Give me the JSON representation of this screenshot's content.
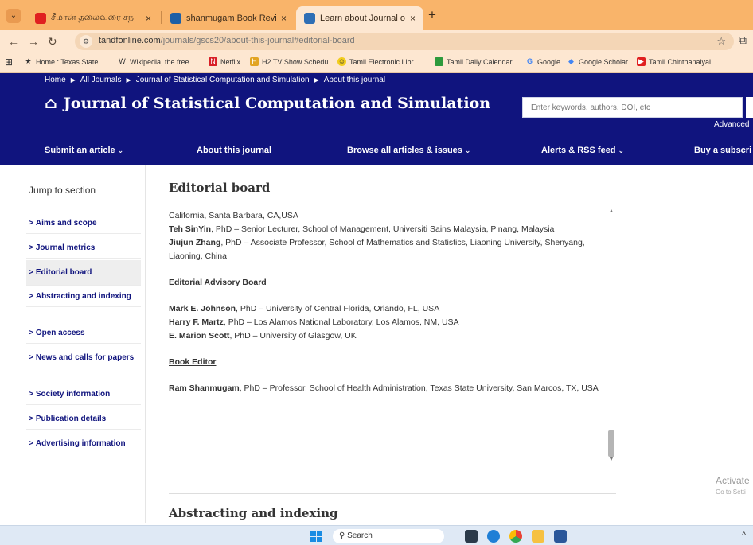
{
  "browser": {
    "tabs": [
      {
        "title": "சீமான் தலைவரை சந்",
        "active": false
      },
      {
        "title": "shanmugam Book Reviews - Sc",
        "active": false
      },
      {
        "title": "Learn about Journal of Statistic",
        "active": true
      }
    ],
    "new_tab": "+",
    "url_domain": "tandfonline.com",
    "url_path": "/journals/gscs20/about-this-journal#editorial-board",
    "bookmarks": [
      "Home : Texas State...",
      "Wikipedia, the free...",
      "Netflix",
      "H2 TV Show Schedu...",
      "Tamil Electronic Libr...",
      "Tamil Daily Calendar...",
      "Google",
      "Google Scholar",
      "Tamil Chinthanaiyal..."
    ]
  },
  "site": {
    "breadcrumb": [
      "Home",
      "All Journals",
      "Journal of Statistical Computation and Simulation",
      "About this journal"
    ],
    "journal_title": "Journal of Statistical Computation and Simulation",
    "search_placeholder": "Enter keywords, authors, DOI, etc",
    "advanced_search": "Advanced",
    "nav": [
      "Submit an article",
      "About this journal",
      "Browse all articles & issues",
      "Alerts & RSS feed",
      "Buy a subscri"
    ]
  },
  "sidebar": {
    "jump_label": "Jump to section",
    "items": [
      "Aims and scope",
      "Journal metrics",
      "Editorial board",
      "Abstracting and indexing",
      "Open access",
      "News and calls for papers",
      "Society information",
      "Publication details",
      "Advertising information"
    ]
  },
  "content": {
    "section_title": "Editorial board",
    "line_1": "California, Santa Barbara, CA,USA",
    "teh_name": "Teh SinYin",
    "teh_rest": ", PhD – Senior Lecturer, School of Management, Universiti Sains Malaysia, Pinang, Malaysia",
    "jiujun_name": "Jiujun Zhang",
    "jiujun_rest": ", PhD – Associate Professor, School of Mathematics and Statistics, Liaoning University, Shenyang, Liaoning, China",
    "advisory_heading": "Editorial Advisory Board",
    "advisory": [
      {
        "name": "Mark E. Johnson",
        "rest": ", PhD – University of Central Florida, Orlando, FL, USA"
      },
      {
        "name": "Harry F. Martz",
        "rest": ", PhD – Los Alamos National Laboratory, Los Alamos, NM, USA"
      },
      {
        "name": "E. Marion Scott",
        "rest": ", PhD – University of Glasgow, UK"
      }
    ],
    "book_heading": "Book Editor",
    "ram_name": "Ram Shanmugam",
    "ram_rest": ", PhD – Professor, School of Health Administration, Texas State University, San Marcos, TX, USA",
    "next_section": "Abstracting and indexing"
  },
  "overlay": {
    "activate_title": "Activate",
    "activate_sub": "Go to Setti"
  },
  "taskbar": {
    "search_label": "Search"
  }
}
